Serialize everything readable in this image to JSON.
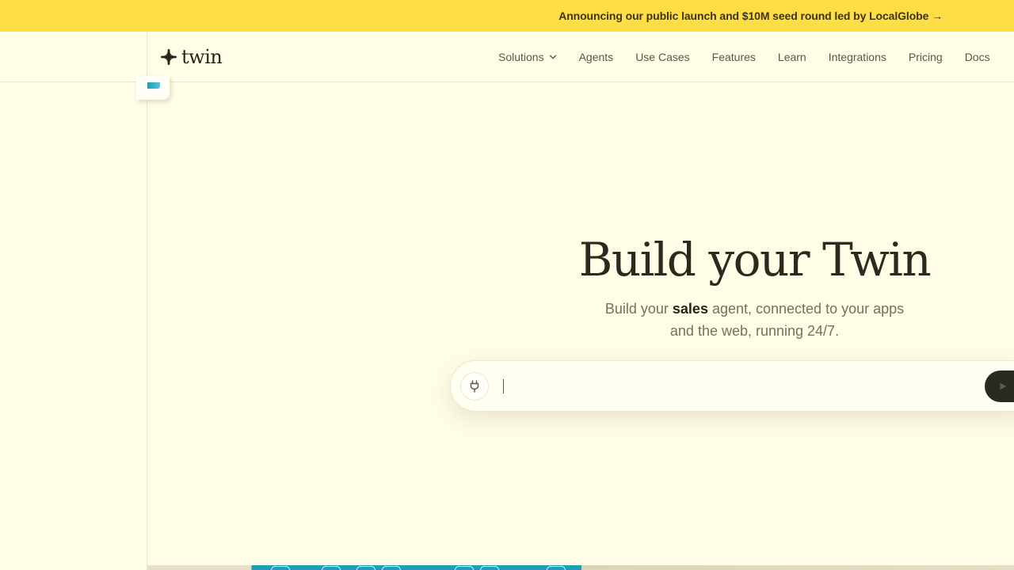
{
  "banner": {
    "text": "Announcing our public launch and $10M seed round led by LocalGlobe →"
  },
  "brand": {
    "name": "twin",
    "logo_icon": "twin-logo-icon"
  },
  "nav": {
    "items": [
      {
        "label": "Solutions",
        "has_dropdown": true
      },
      {
        "label": "Agents"
      },
      {
        "label": "Use Cases"
      },
      {
        "label": "Features"
      },
      {
        "label": "Learn"
      },
      {
        "label": "Integrations"
      },
      {
        "label": "Pricing"
      },
      {
        "label": "Docs"
      }
    ]
  },
  "hero": {
    "title": "Build your Twin",
    "subtitle_prefix": "Build your ",
    "subtitle_highlight": "sales",
    "subtitle_suffix": " agent, connected to your apps and the web, running 24/7."
  },
  "prompt": {
    "value": "",
    "placeholder": "",
    "plug_icon": "plug-icon",
    "send_icon": "play-icon"
  },
  "colors": {
    "banner_bg": "#ffdd45",
    "page_bg": "#fffde6",
    "text_dark": "#2b2920",
    "text_muted": "#74715e",
    "accent_teal": "#1f9fb7",
    "button_dark": "#2b2a22"
  }
}
